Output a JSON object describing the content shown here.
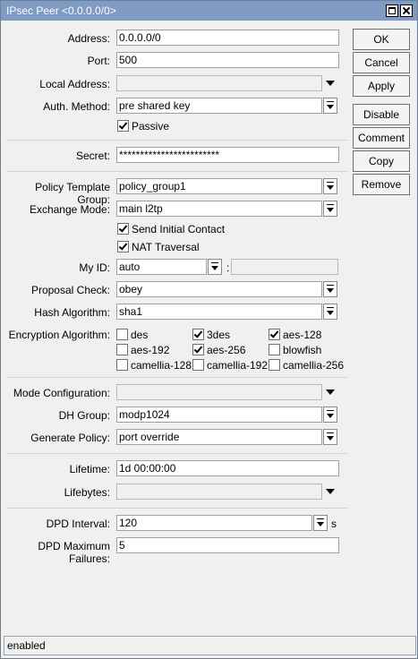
{
  "window": {
    "title": "IPsec Peer <0.0.0.0/0>"
  },
  "buttons": {
    "ok": "OK",
    "cancel": "Cancel",
    "apply": "Apply",
    "disable": "Disable",
    "comment": "Comment",
    "copy": "Copy",
    "remove": "Remove"
  },
  "form": {
    "address": {
      "label": "Address:",
      "value": "0.0.0.0/0"
    },
    "port": {
      "label": "Port:",
      "value": "500"
    },
    "local_address": {
      "label": "Local Address:",
      "value": ""
    },
    "auth_method": {
      "label": "Auth. Method:",
      "value": "pre shared key"
    },
    "passive": {
      "label": "Passive",
      "checked": true
    },
    "secret": {
      "label": "Secret:",
      "value": "************************"
    },
    "policy_template_group": {
      "label": "Policy Template Group:",
      "value": "policy_group1"
    },
    "exchange_mode": {
      "label": "Exchange Mode:",
      "value": "main l2tp"
    },
    "send_initial_contact": {
      "label": "Send Initial Contact",
      "checked": true
    },
    "nat_traversal": {
      "label": "NAT Traversal",
      "checked": true
    },
    "my_id": {
      "label": "My ID:",
      "value": "auto",
      "separator": ":",
      "extra": ""
    },
    "proposal_check": {
      "label": "Proposal Check:",
      "value": "obey"
    },
    "hash_algorithm": {
      "label": "Hash Algorithm:",
      "value": "sha1"
    },
    "encryption": {
      "label": "Encryption Algorithm:",
      "options": [
        {
          "label": "des",
          "checked": false
        },
        {
          "label": "3des",
          "checked": true
        },
        {
          "label": "aes-128",
          "checked": true
        },
        {
          "label": "aes-192",
          "checked": false
        },
        {
          "label": "aes-256",
          "checked": true
        },
        {
          "label": "blowfish",
          "checked": false
        },
        {
          "label": "camellia-128",
          "checked": false
        },
        {
          "label": "camellia-192",
          "checked": false
        },
        {
          "label": "camellia-256",
          "checked": false
        }
      ]
    },
    "mode_configuration": {
      "label": "Mode Configuration:",
      "value": ""
    },
    "dh_group": {
      "label": "DH Group:",
      "value": "modp1024"
    },
    "generate_policy": {
      "label": "Generate Policy:",
      "value": "port override"
    },
    "lifetime": {
      "label": "Lifetime:",
      "value": "1d 00:00:00"
    },
    "lifebytes": {
      "label": "Lifebytes:",
      "value": ""
    },
    "dpd_interval": {
      "label": "DPD Interval:",
      "value": "120",
      "unit": "s"
    },
    "dpd_max_failures": {
      "label": "DPD Maximum Failures:",
      "value": "5"
    }
  },
  "status": {
    "text": "enabled"
  }
}
